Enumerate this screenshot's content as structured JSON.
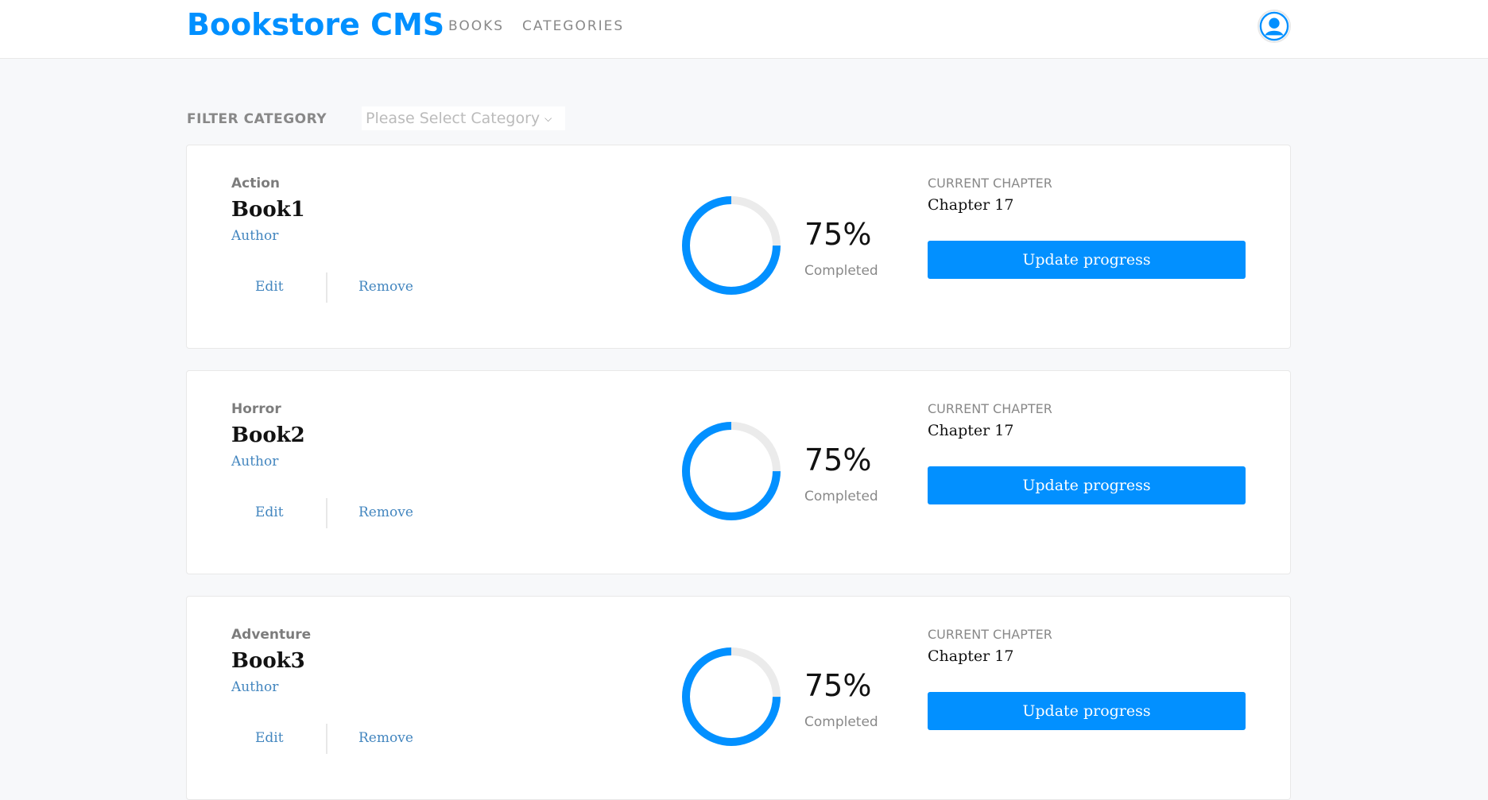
{
  "header": {
    "brand": "Bookstore CMS",
    "nav": {
      "books": "BOOKS",
      "categories": "CATEGORIES"
    },
    "accent_color": "#0290ff"
  },
  "filter": {
    "label": "FILTER CATEGORY",
    "select_value": "Please Select Category"
  },
  "books": [
    {
      "genre": "Action",
      "title": "Book1",
      "author": "Author",
      "edit_label": "Edit",
      "remove_label": "Remove",
      "progress": 0.75,
      "percent_text": "75%",
      "completed_label": "Completed",
      "chapter_label": "CURRENT CHAPTER",
      "chapter": "Chapter 17",
      "update_label": "Update progress"
    },
    {
      "genre": "Horror",
      "title": "Book2",
      "author": "Author",
      "edit_label": "Edit",
      "remove_label": "Remove",
      "progress": 0.75,
      "percent_text": "75%",
      "completed_label": "Completed",
      "chapter_label": "CURRENT CHAPTER",
      "chapter": "Chapter 17",
      "update_label": "Update progress"
    },
    {
      "genre": "Adventure",
      "title": "Book3",
      "author": "Author",
      "edit_label": "Edit",
      "remove_label": "Remove",
      "progress": 0.75,
      "percent_text": "75%",
      "completed_label": "Completed",
      "chapter_label": "CURRENT CHAPTER",
      "chapter": "Chapter 17",
      "update_label": "Update progress"
    }
  ]
}
